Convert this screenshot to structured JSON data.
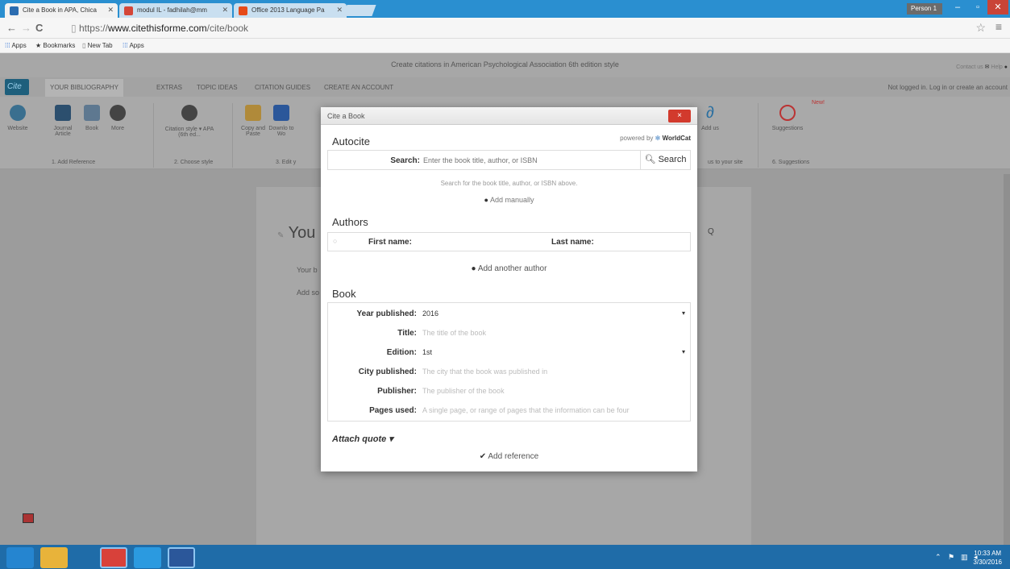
{
  "browser": {
    "tabs": [
      {
        "label": "Cite a Book in APA, Chica",
        "color": "#2b6cb0"
      },
      {
        "label": "modul IL - fadhilah@mm",
        "color": "#d44638"
      },
      {
        "label": "Office 2013 Language Pa",
        "color": "#e64a19"
      }
    ],
    "profile": "Person 1",
    "url_prefix": "https://",
    "url_domain": "www.citethisforme.com",
    "url_path": "/cite/book",
    "bookmarks": [
      "Apps",
      "Bookmarks",
      "New Tab",
      "Apps"
    ]
  },
  "site": {
    "banner": "Create citations in American Psychological Association 6th edition style",
    "contact": "Contact us",
    "help": "Help",
    "logo": "Cite",
    "nav": [
      "YOUR BIBLIOGRAPHY",
      "EXTRAS",
      "TOPIC IDEAS",
      "CITATION GUIDES",
      "CREATE AN ACCOUNT"
    ],
    "login": "Not logged in. Log in or create an account",
    "ribbon": {
      "website": "Website",
      "journal": "Journal Article",
      "book": "Book",
      "more": "More",
      "style": "Citation style ▾ APA (6th ed...",
      "copy": "Copy and Paste",
      "download": "Downlo to Wo",
      "add_us": "Add us",
      "suggestions": "Suggestions",
      "new": "New!",
      "sec1": "1. Add Reference",
      "sec2": "2. Choose style",
      "sec3": "3. Edit y",
      "sec5": "us to your site",
      "sec6": "6. Suggestions"
    },
    "page_heading_fragment": "You",
    "page_text1": "Your b",
    "page_text2": "Add so"
  },
  "modal": {
    "title": "Cite a Book",
    "close": "×",
    "autocite": "Autocite",
    "powered_by": "powered by",
    "worldcat": "WorldCat",
    "search_label": "Search:",
    "search_placeholder": "Enter the book title, author, or ISBN",
    "search_button": "Search",
    "search_hint": "Search for the book title, author, or ISBN above.",
    "add_manually": "Add manually",
    "authors_title": "Authors",
    "first_name_label": "First name:",
    "last_name_label": "Last name:",
    "add_author": "Add another author",
    "book_title": "Book",
    "fields": [
      {
        "label": "Year published:",
        "value": "2016",
        "placeholder": false,
        "dropdown": true
      },
      {
        "label": "Title:",
        "value": "The title of the book",
        "placeholder": true,
        "dropdown": false
      },
      {
        "label": "Edition:",
        "value": "1st",
        "placeholder": false,
        "dropdown": true
      },
      {
        "label": "City published:",
        "value": "The city that the book was published in",
        "placeholder": true,
        "dropdown": false
      },
      {
        "label": "Publisher:",
        "value": "The publisher of the book",
        "placeholder": true,
        "dropdown": false
      },
      {
        "label": "Pages used:",
        "value": "A single page, or range of pages that the information can be four",
        "placeholder": true,
        "dropdown": false
      }
    ],
    "attach_quote": "Attach quote ▾",
    "add_reference": "Add reference"
  },
  "taskbar": {
    "time": "10:33 AM",
    "date": "3/30/2016"
  }
}
